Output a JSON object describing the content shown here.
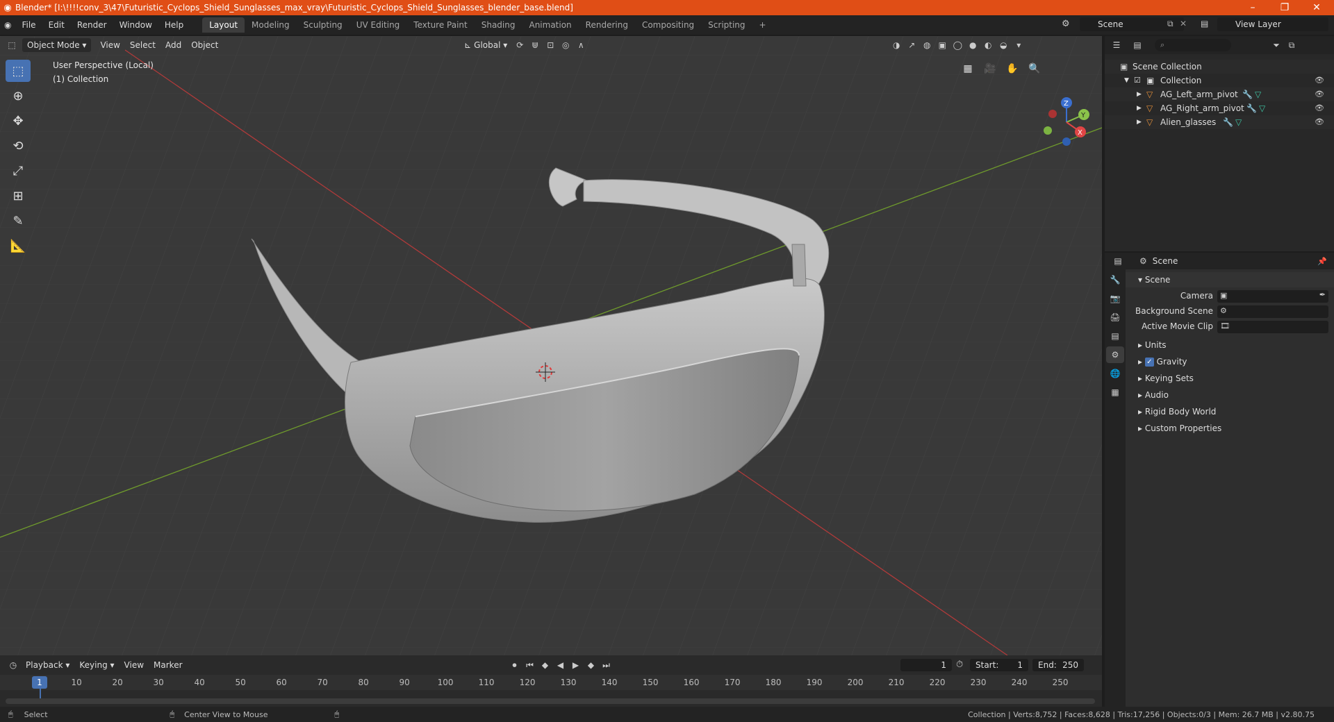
{
  "window": {
    "title": "Blender* [I:\\!!!!conv_3\\47\\Futuristic_Cyclops_Shield_Sunglasses_max_vray\\Futuristic_Cyclops_Shield_Sunglasses_blender_base.blend]",
    "accent": "#e04e16"
  },
  "menu": {
    "file": "File",
    "edit": "Edit",
    "render": "Render",
    "window": "Window",
    "help": "Help"
  },
  "workspaces": [
    "Layout",
    "Modeling",
    "Sculpting",
    "UV Editing",
    "Texture Paint",
    "Shading",
    "Animation",
    "Rendering",
    "Compositing",
    "Scripting"
  ],
  "scene_selector": "Scene",
  "view_layer": "View Layer",
  "viewport": {
    "mode": "Object Mode",
    "menus": {
      "view": "View",
      "select": "Select",
      "add": "Add",
      "object": "Object"
    },
    "orientation": "Global",
    "info_line1": "User Perspective (Local)",
    "info_line2": "(1) Collection",
    "gizmo": {
      "z": "Z",
      "y": "Y",
      "x": "X"
    }
  },
  "outliner": {
    "root": "Scene Collection",
    "collection": "Collection",
    "items": [
      "AG_Left_arm_pivot",
      "AG_Right_arm_pivot",
      "Alien_glasses"
    ]
  },
  "properties": {
    "header": "Scene",
    "panel": "Scene",
    "camera_label": "Camera",
    "background_scene_label": "Background Scene",
    "active_movie_clip_label": "Active Movie Clip",
    "sections": [
      "Units",
      "Gravity",
      "Keying Sets",
      "Audio",
      "Rigid Body World",
      "Custom Properties"
    ]
  },
  "timeline": {
    "playback": "Playback",
    "keying": "Keying",
    "view": "View",
    "marker": "Marker",
    "current_frame": "1",
    "start_label": "Start:",
    "start": "1",
    "end_label": "End:",
    "end": "250",
    "ticks": [
      "1",
      "10",
      "20",
      "30",
      "40",
      "50",
      "60",
      "70",
      "80",
      "90",
      "100",
      "110",
      "120",
      "130",
      "140",
      "150",
      "160",
      "170",
      "180",
      "190",
      "200",
      "210",
      "220",
      "230",
      "240",
      "250"
    ]
  },
  "status": {
    "select": "Select",
    "center_view": "Center View to Mouse",
    "stats": "Collection | Verts:8,752 | Faces:8,628 | Tris:17,256 | Objects:0/3 | Mem: 26.7 MB | v2.80.75"
  }
}
